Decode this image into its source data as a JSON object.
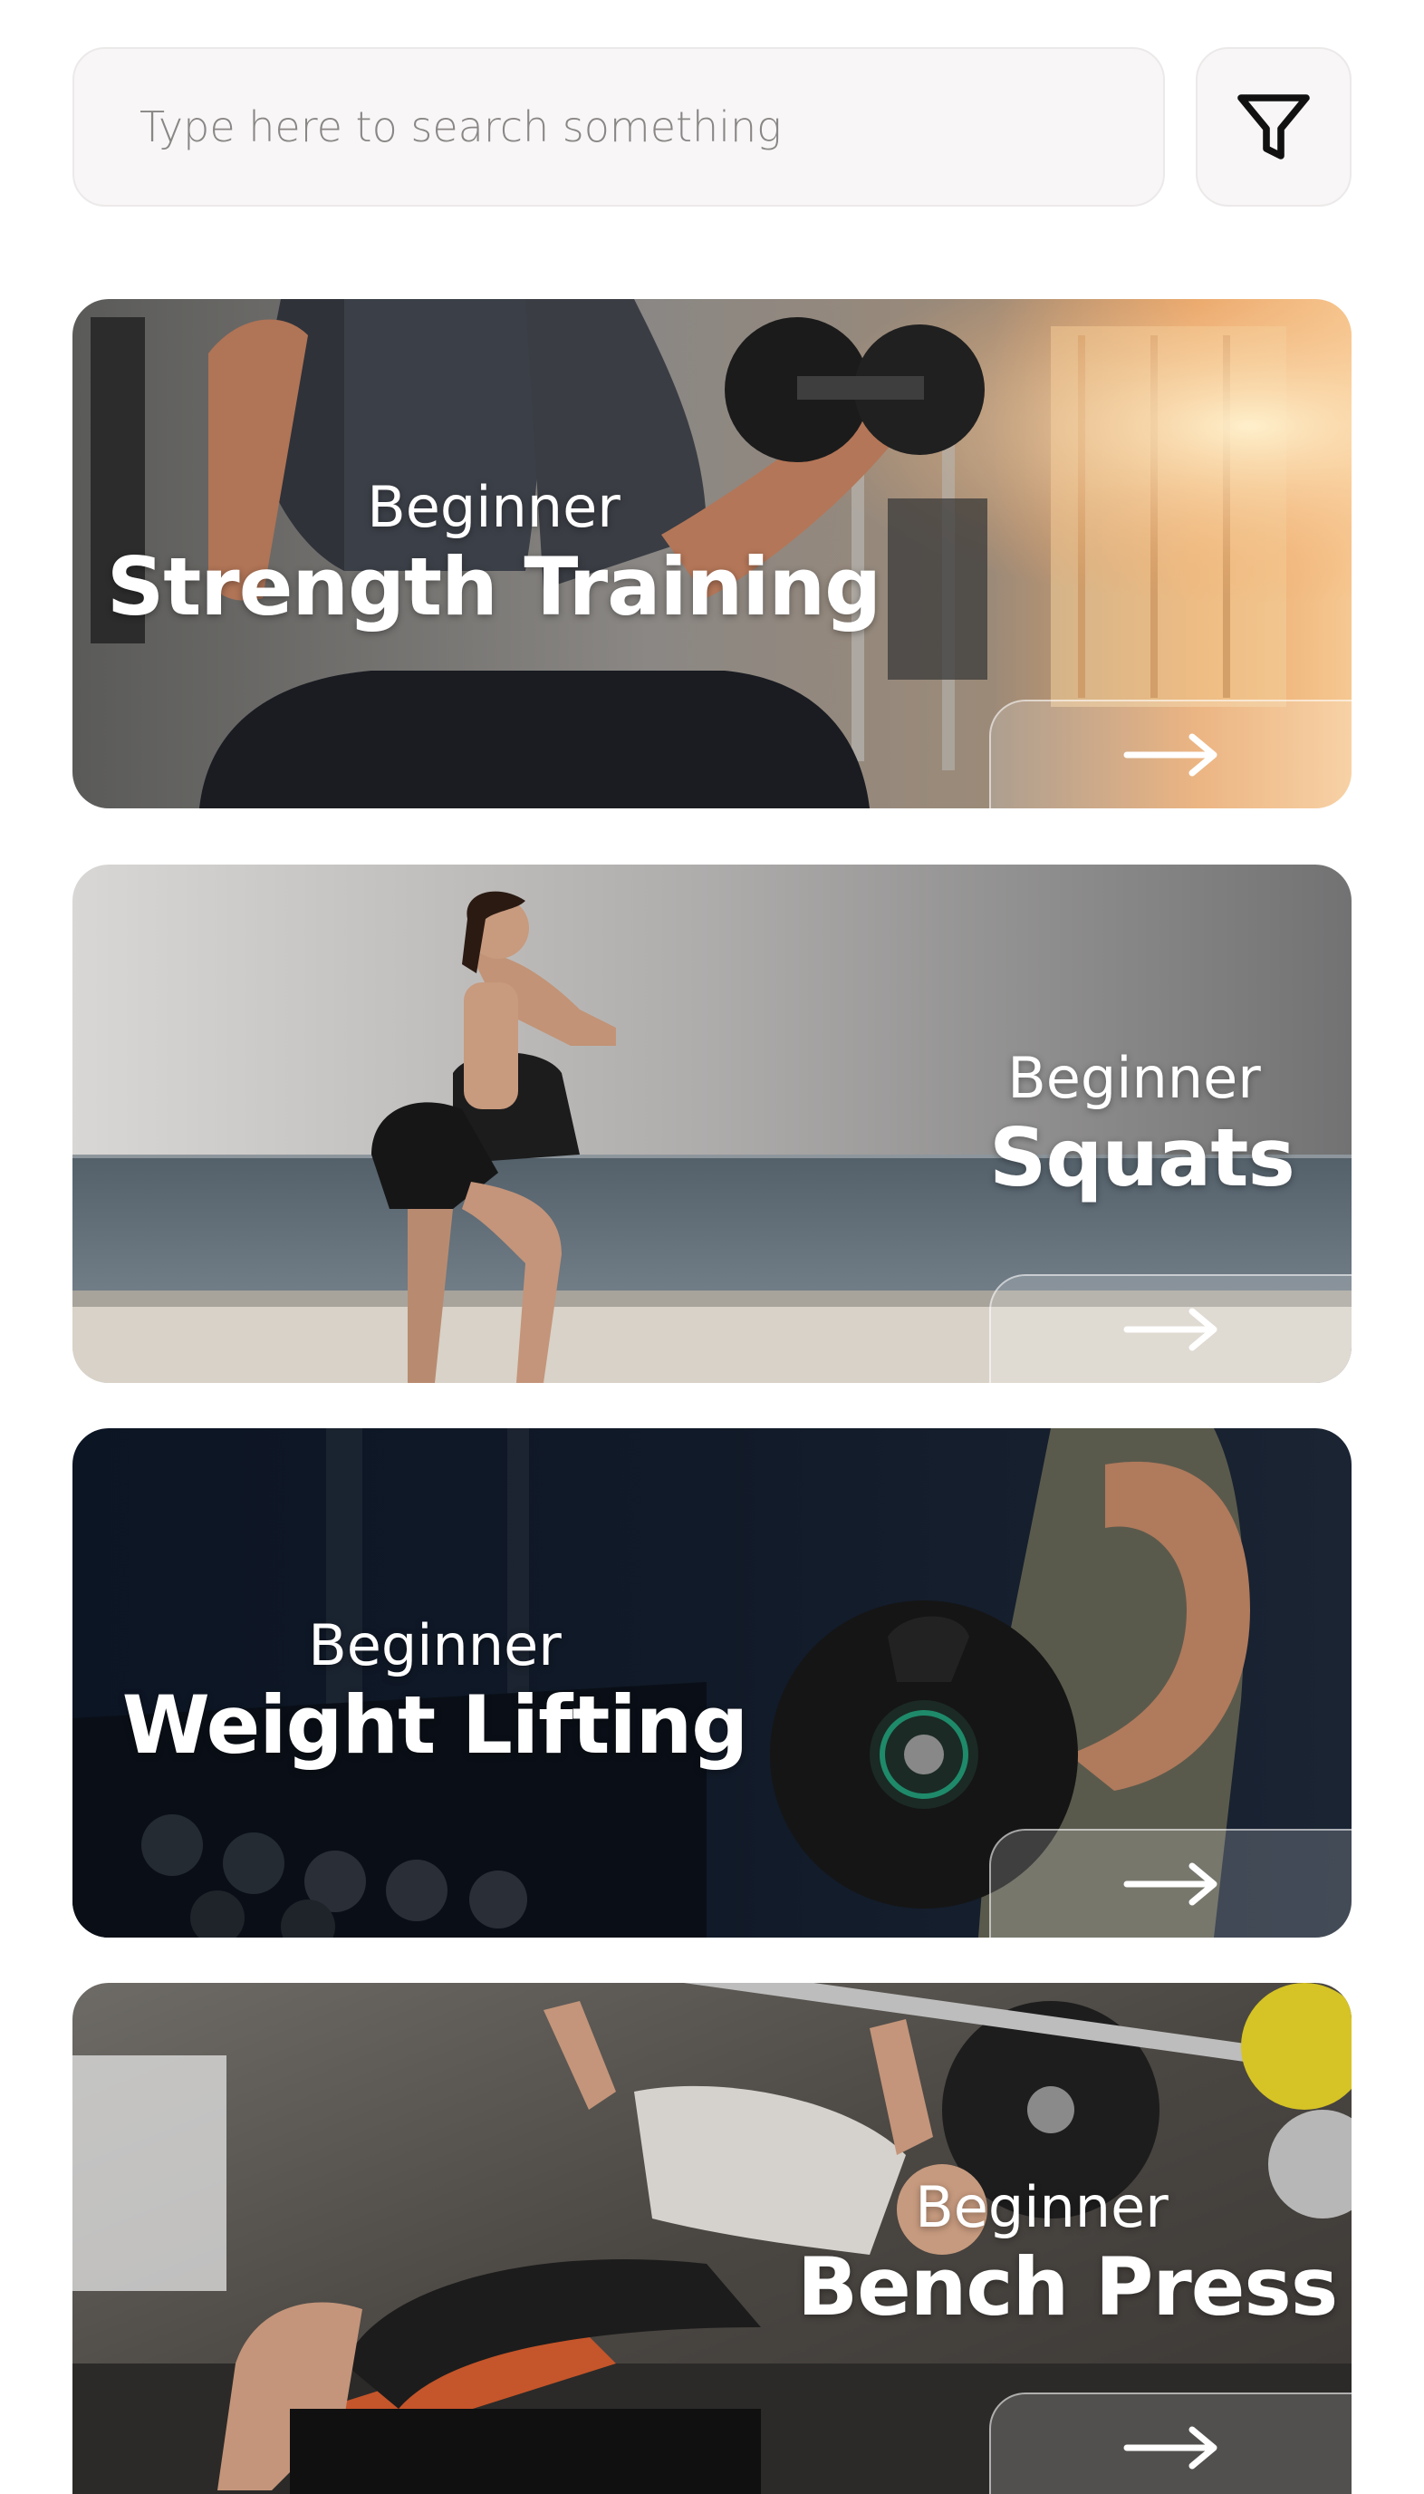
{
  "search": {
    "placeholder": "Type here to search something",
    "value": ""
  },
  "filter": {
    "icon": "filter-funnel-icon"
  },
  "cards": [
    {
      "level": "Beginner",
      "title": "Strength Training",
      "arrow_icon": "arrow-right-icon"
    },
    {
      "level": "Beginner",
      "title": "Squats",
      "arrow_icon": "arrow-right-icon"
    },
    {
      "level": "Beginner",
      "title": "Weight Lifting",
      "arrow_icon": "arrow-right-icon"
    },
    {
      "level": "Beginner",
      "title": "Bench Press",
      "arrow_icon": "arrow-right-icon"
    }
  ],
  "colors": {
    "background": "#ffffff",
    "input_background": "#f8f6f6",
    "input_border": "#ece9e9",
    "placeholder_text": "#8a8686",
    "card_text": "#ffffff"
  }
}
